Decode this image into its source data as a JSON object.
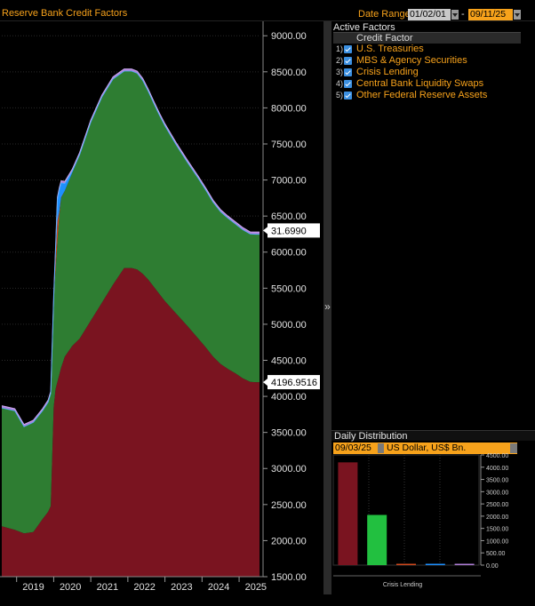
{
  "header": {
    "title": "Reserve Bank Credit Factors",
    "date_range_label": "Date Range",
    "start_date": "01/02/01",
    "separator": "-",
    "end_date": "09/11/25"
  },
  "side_panel": {
    "active_factors_label": "Active Factors",
    "column_header": "Credit Factor",
    "factors": [
      {
        "num": "1)",
        "label": "U.S. Treasuries",
        "checked": true
      },
      {
        "num": "2)",
        "label": "MBS & Agency Securities",
        "checked": true
      },
      {
        "num": "3)",
        "label": "Crisis Lending",
        "checked": true
      },
      {
        "num": "4)",
        "label": "Central Bank Liquidity Swaps",
        "checked": true
      },
      {
        "num": "5)",
        "label": "Other Federal Reserve Assets",
        "checked": true
      }
    ],
    "collapse_glyph": "»",
    "icon": "chevron-double-right-icon"
  },
  "distribution": {
    "header": "Daily Distribution",
    "date": "09/03/25",
    "unit": "US Dollar, US$ Bn."
  },
  "chart_data": [
    {
      "type": "area",
      "stacked": true,
      "x_tick_labels": [
        "2019",
        "2020",
        "2021",
        "2022",
        "2023",
        "2024",
        "2025"
      ],
      "y_tick_labels": [
        "9000.00",
        "8500.00",
        "8000.00",
        "7500.00",
        "7000.00",
        "6500.00",
        "6000.00",
        "5500.00",
        "5000.00",
        "4500.00",
        "4000.00",
        "3500.00",
        "3000.00",
        "2500.00",
        "2000.00",
        "1500.00"
      ],
      "ylim": [
        1500,
        9200
      ],
      "x": [
        2018.6,
        2018.95,
        2019.2,
        2019.45,
        2019.7,
        2019.85,
        2019.92,
        2020.0,
        2020.05,
        2020.1,
        2020.15,
        2020.2,
        2020.3,
        2020.5,
        2020.7,
        2021.0,
        2021.3,
        2021.6,
        2021.9,
        2022.1,
        2022.25,
        2022.4,
        2022.55,
        2022.7,
        2022.85,
        2023.0,
        2023.3,
        2023.6,
        2023.9,
        2024.1,
        2024.3,
        2024.5,
        2024.7,
        2024.9,
        2025.1,
        2025.3,
        2025.45,
        2025.55
      ],
      "series": [
        {
          "name": "U.S. Treasuries",
          "color": "#7a1420",
          "values": [
            2200,
            2150,
            2100,
            2120,
            2300,
            2400,
            2480,
            3850,
            4100,
            4200,
            4300,
            4400,
            4550,
            4700,
            4800,
            5050,
            5300,
            5550,
            5780,
            5780,
            5760,
            5700,
            5620,
            5520,
            5420,
            5320,
            5150,
            4980,
            4800,
            4680,
            4550,
            4450,
            4380,
            4320,
            4250,
            4200,
            4197,
            4197
          ]
        },
        {
          "name": "MBS & Agency Securities",
          "color": "#2e7d32",
          "values": [
            1640,
            1650,
            1480,
            1520,
            1500,
            1520,
            1560,
            1500,
            1650,
            1950,
            2200,
            2350,
            2300,
            2400,
            2550,
            2750,
            2850,
            2850,
            2730,
            2730,
            2720,
            2680,
            2610,
            2540,
            2480,
            2430,
            2340,
            2270,
            2220,
            2180,
            2140,
            2110,
            2090,
            2070,
            2060,
            2050,
            2050,
            2050
          ]
        },
        {
          "name": "Crisis Lending",
          "color": "#d24a1e",
          "values": [
            0,
            0,
            0,
            0,
            0,
            0,
            0,
            0,
            180,
            280,
            60,
            10,
            0,
            0,
            0,
            0,
            0,
            0,
            0,
            0,
            0,
            0,
            0,
            0,
            0,
            0,
            0,
            0,
            0,
            0,
            0,
            0,
            0,
            0,
            0,
            0,
            0,
            0
          ]
        },
        {
          "name": "Central Bank Liquidity Swaps",
          "color": "#1e90ff",
          "values": [
            0,
            0,
            0,
            0,
            0,
            0,
            0,
            0,
            100,
            300,
            300,
            200,
            100,
            20,
            0,
            0,
            0,
            0,
            0,
            0,
            0,
            0,
            0,
            0,
            0,
            0,
            0,
            0,
            0,
            0,
            0,
            0,
            0,
            0,
            0,
            0,
            0,
            0
          ]
        },
        {
          "name": "Other Federal Reserve Assets",
          "color": "#b07fd8",
          "values": [
            30,
            30,
            30,
            30,
            30,
            30,
            30,
            30,
            30,
            30,
            30,
            30,
            30,
            30,
            30,
            30,
            30,
            30,
            30,
            30,
            30,
            30,
            30,
            30,
            30,
            30,
            30,
            30,
            30,
            30,
            30,
            30,
            30,
            30,
            30,
            30,
            32,
            32
          ]
        }
      ],
      "last_value_tags": [
        "31.6990",
        "4196.9516"
      ]
    },
    {
      "type": "bar",
      "categories": [
        "U.S. Treasuries",
        "MBS & Agency Securities",
        "Crisis Lending",
        "Central Bank Liquidity Swaps",
        "Other Federal Reserve Assets"
      ],
      "values": [
        4197,
        2050,
        6,
        2,
        32
      ],
      "colors": [
        "#7a1420",
        "#22c040",
        "#d24a1e",
        "#1e90ff",
        "#b07fd8"
      ],
      "y_tick_labels": [
        "4500.00",
        "4000.00",
        "3500.00",
        "3000.00",
        "2500.00",
        "2000.00",
        "1500.00",
        "1000.00",
        "500.00",
        "0.00"
      ],
      "ylim": [
        0,
        4500
      ],
      "xlabel": "Crisis Lending"
    }
  ]
}
